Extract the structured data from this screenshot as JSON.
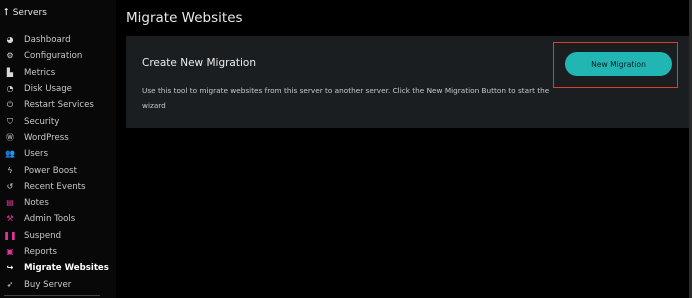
{
  "sidebar": {
    "back_label": "Servers",
    "items": [
      {
        "label": "Dashboard",
        "icon": "dashboard-icon",
        "glyph": "◕",
        "color": "#d8d8d8"
      },
      {
        "label": "Configuration",
        "icon": "cogs-icon",
        "glyph": "⚙",
        "color": "#d8d8d8"
      },
      {
        "label": "Metrics",
        "icon": "chart-area-icon",
        "glyph": "▙",
        "color": "#d8d8d8"
      },
      {
        "label": "Disk Usage",
        "icon": "pie-chart-icon",
        "glyph": "◔",
        "color": "#d8d8d8"
      },
      {
        "label": "Restart Services",
        "icon": "power-icon",
        "glyph": "⏻",
        "color": "#d8d8d8"
      },
      {
        "label": "Security",
        "icon": "shield-icon",
        "glyph": "⛉",
        "color": "#d8d8d8"
      },
      {
        "label": "WordPress",
        "icon": "wordpress-icon",
        "glyph": "Ⓦ",
        "color": "#d8d8d8"
      },
      {
        "label": "Users",
        "icon": "users-icon",
        "glyph": "👥",
        "color": "#d8d8d8"
      },
      {
        "label": "Power Boost",
        "icon": "bolt-icon",
        "glyph": "ϟ",
        "color": "#d8d8d8"
      },
      {
        "label": "Recent Events",
        "icon": "history-icon",
        "glyph": "↺",
        "color": "#d8d8d8"
      },
      {
        "label": "Notes",
        "icon": "note-icon",
        "glyph": "▤",
        "color": "#e0369e"
      },
      {
        "label": "Admin Tools",
        "icon": "wrench-icon",
        "glyph": "⚒",
        "color": "#e0369e"
      },
      {
        "label": "Suspend",
        "icon": "pause-icon",
        "glyph": "❚❚",
        "color": "#e0369e"
      },
      {
        "label": "Reports",
        "icon": "report-icon",
        "glyph": "▣",
        "color": "#e0369e"
      },
      {
        "label": "Migrate Websites",
        "icon": "sign-out-icon",
        "glyph": "↪",
        "color": "#ffffff",
        "active": true
      },
      {
        "label": "Buy Server",
        "icon": "rocket-icon",
        "glyph": "➶",
        "color": "#d8d8d8"
      }
    ]
  },
  "main": {
    "title": "Migrate Websites",
    "card": {
      "title": "Create New Migration",
      "description": "Use this tool to migrate websites from this server to another server. Click the New Migration Button to start the wizard",
      "button_label": "New Migration"
    }
  },
  "colors": {
    "accent": "#21b6b3",
    "highlight_border": "#d9412b",
    "card_bg": "#1a1e21",
    "pink_icon": "#e0369e"
  }
}
